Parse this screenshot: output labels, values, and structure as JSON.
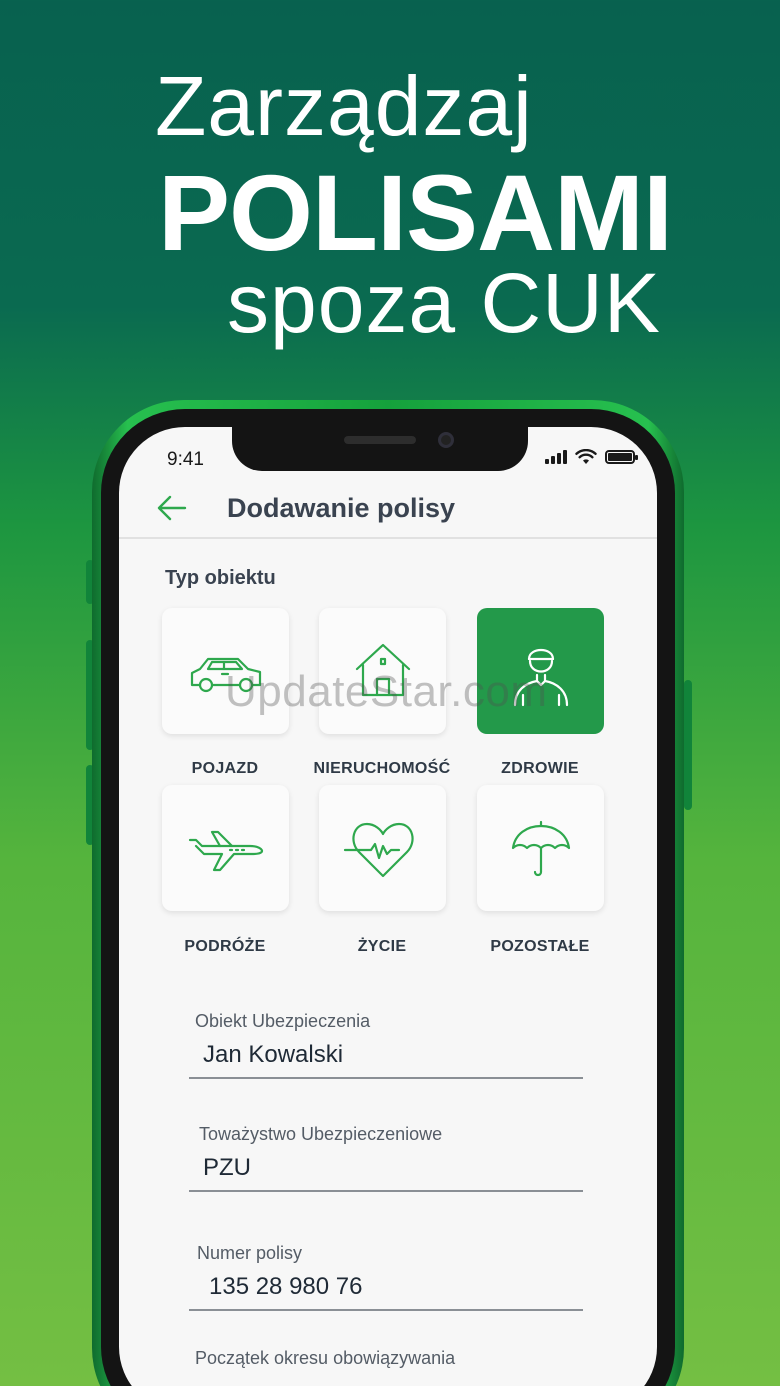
{
  "hero": {
    "line1": "Zarządzaj",
    "line2": "POLISAMI",
    "line3": "spoza CUK"
  },
  "status": {
    "time": "9:41",
    "battery_level": 1.0
  },
  "appbar": {
    "title": "Dodawanie polisy",
    "back_icon": "arrow-left-icon"
  },
  "object_type": {
    "label": "Typ obiektu",
    "selected": "ZDROWIE",
    "tiles": [
      {
        "label": "POJAZD",
        "icon": "car-icon",
        "active": false
      },
      {
        "label": "NIERUCHOMOŚĆ",
        "icon": "house-icon",
        "active": false
      },
      {
        "label": "ZDROWIE",
        "icon": "person-icon",
        "active": true
      },
      {
        "label": "PODRÓŻE",
        "icon": "airplane-icon",
        "active": false
      },
      {
        "label": "ŻYCIE",
        "icon": "heartbeat-icon",
        "active": false
      },
      {
        "label": "POZOSTAŁE",
        "icon": "umbrella-icon",
        "active": false
      }
    ]
  },
  "form": {
    "insured_object": {
      "label": "Obiekt Ubezpieczenia",
      "value": "Jan Kowalski"
    },
    "insurer": {
      "label": "Toważystwo Ubezpieczeniowe",
      "value": "PZU"
    },
    "policy_number": {
      "label": "Numer polisy",
      "value": "135 28 980 76"
    },
    "start_date": {
      "label": "Początek okresu obowiązywania",
      "value": ""
    }
  },
  "watermark": "UpdateStar.com",
  "colors": {
    "brand_green": "#23994a",
    "icon_green": "#2ea84d",
    "bg_top": "#08614f",
    "bg_bottom": "#74bf43",
    "text_dark": "#3a4350"
  }
}
